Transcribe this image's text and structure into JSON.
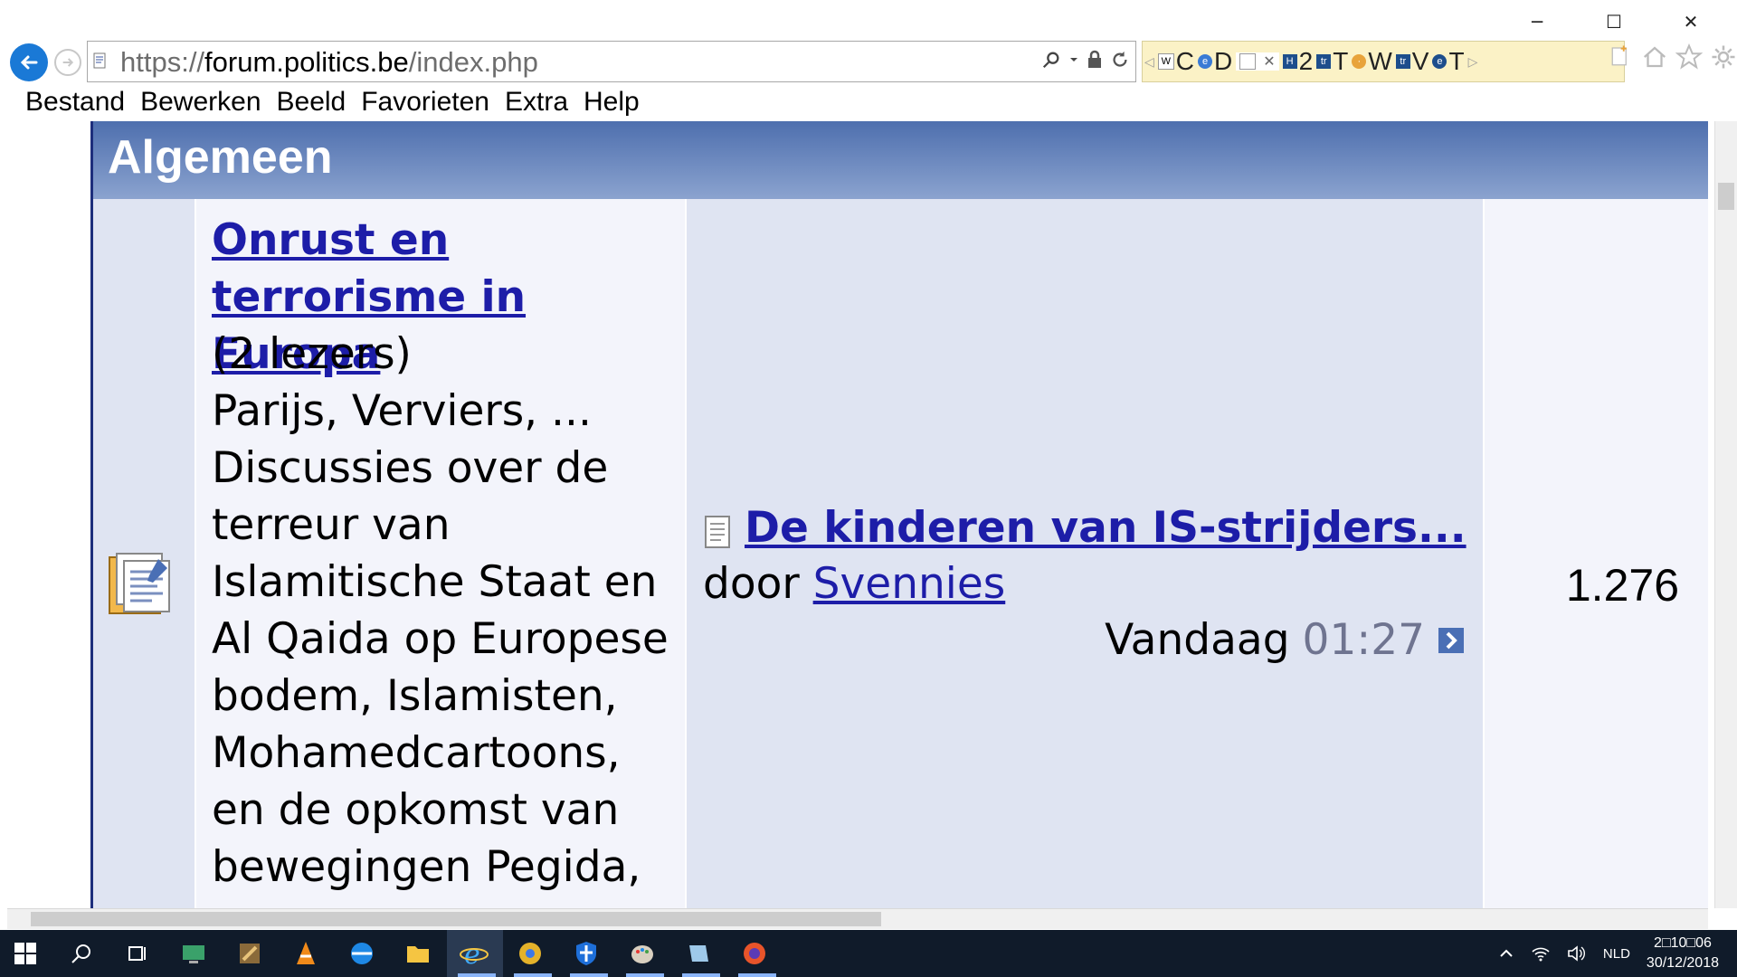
{
  "browser": {
    "url_scheme": "https://",
    "url_domain": "forum.politics.be",
    "url_path": "/index.php",
    "tabs": [
      "C",
      "D",
      "2",
      "T",
      "W",
      "V",
      "T"
    ],
    "win_min": "─",
    "win_max": "☐",
    "win_close": "✕"
  },
  "menu": {
    "items": [
      "Bestand",
      "Bewerken",
      "Beeld",
      "Favorieten",
      "Extra",
      "Help"
    ]
  },
  "forum": {
    "category_title": "Algemeen",
    "title": "Onrust en terrorisme in Europa",
    "readers": "(2 lezers)",
    "description": "Parijs, Verviers, ... Discussies over de terreur van Islamitische Staat en Al Qaida op Europese bodem, Islamisten, Mohamedcartoons, en de opkomst van bewegingen Pegida,",
    "last_post": {
      "topic": "De kinderen van IS-strijders...",
      "by_label": "door",
      "author": "Svennies",
      "date": "Vandaag",
      "time": "01:27"
    },
    "count": "1.276"
  },
  "taskbar": {
    "language": "NLD",
    "time": "2□10□06",
    "date": "30/12/2018"
  }
}
